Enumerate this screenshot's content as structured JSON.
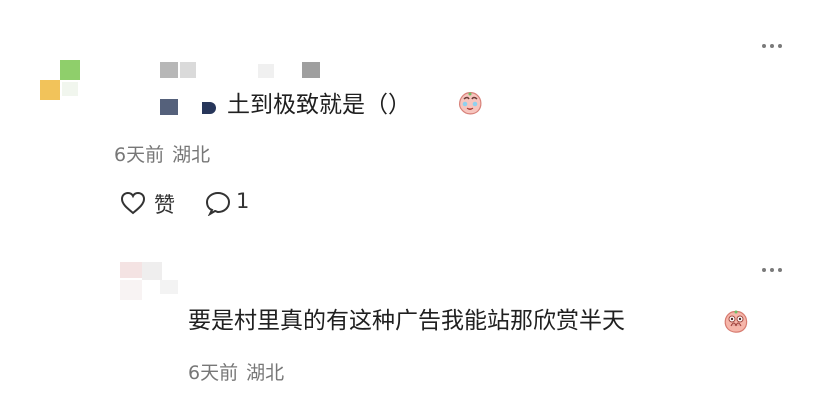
{
  "comments": [
    {
      "text": "土到极致就是（）",
      "time": "6天前",
      "location": "湖北",
      "emoji": "crying-face-emoji",
      "like_label": "赞",
      "reply_count": "1"
    },
    {
      "text": "要是村里真的有这种广告我能站那欣赏半天",
      "time": "6天前",
      "location": "湖北",
      "emoji": "pleading-face-emoji"
    }
  ],
  "icons": {
    "more": "more-horizontal-icon",
    "like": "heart-outline-icon",
    "reply": "comment-bubble-icon"
  },
  "colors": {
    "text": "#202020",
    "meta": "#777777",
    "icon": "#333333",
    "avatar_green": "#8fcf6b",
    "avatar_yellow": "#f2c35a"
  }
}
